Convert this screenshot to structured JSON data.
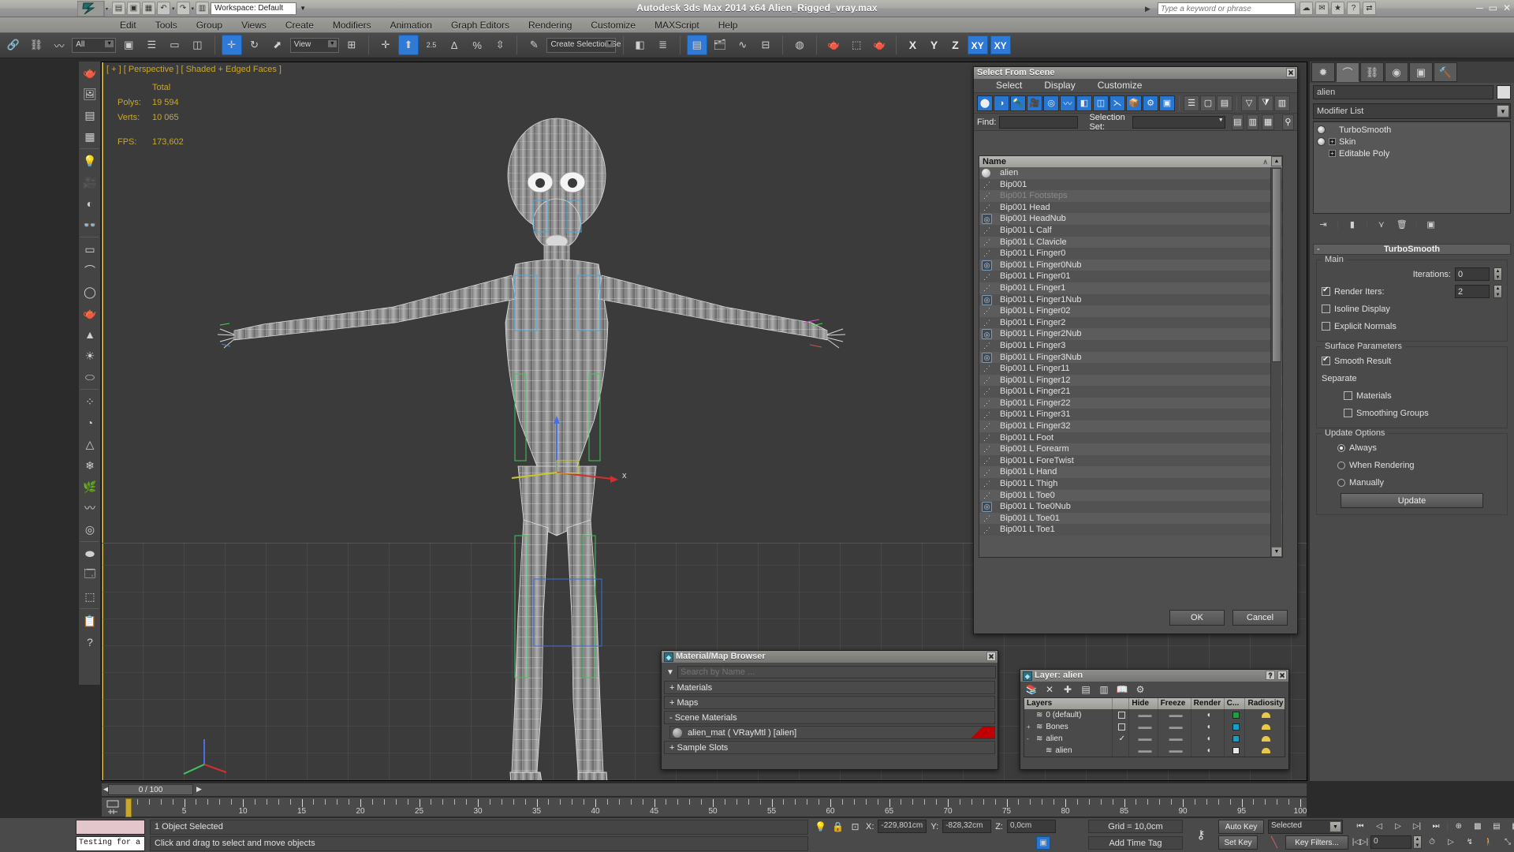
{
  "titlebar": {
    "title": "Autodesk 3ds Max  2014 x64    Alien_Rigged_vray.max",
    "quick_access": [
      "new-icon",
      "open-icon",
      "save-icon",
      "undo-icon",
      "redo-icon",
      "setproject-icon"
    ],
    "workspace_label": "Workspace: Default",
    "search_placeholder": "Type a keyword or phrase",
    "window_buttons": [
      "minimize",
      "maximize",
      "close"
    ]
  },
  "menu": {
    "items": [
      "Edit",
      "Tools",
      "Group",
      "Views",
      "Create",
      "Modifiers",
      "Animation",
      "Graph Editors",
      "Rendering",
      "Customize",
      "MAXScript",
      "Help"
    ]
  },
  "toolbar": {
    "selection_filter": "All",
    "reference_coord": "View",
    "named_selection_sets": "Create Selection Se",
    "axis_buttons": [
      "X",
      "Y",
      "Z"
    ],
    "axis_plane": "XY",
    "axis_plane_snap": "XY",
    "percent_snap_label": "%",
    "angle_snap_label": "2.5"
  },
  "viewport": {
    "label": "[ + ] [ Perspective ] [ Shaded + Edged Faces ]",
    "stats_header": "Total",
    "stats": [
      {
        "label": "Polys:",
        "value": "19 594"
      },
      {
        "label": "Verts:",
        "value": "10 065"
      }
    ],
    "fps_label": "FPS:",
    "fps_value": "173,602",
    "accent_color": "#c9a72c"
  },
  "select_from_scene": {
    "title": "Select From Scene",
    "menus": [
      "Select",
      "Display",
      "Customize"
    ],
    "find_label": "Find:",
    "find_value": "",
    "selection_set_label": "Selection Set:",
    "selection_set_value": "",
    "column_header": "Name",
    "ok_label": "OK",
    "cancel_label": "Cancel",
    "rows": [
      {
        "name": "alien",
        "icon": "sphere-icon",
        "dim": false
      },
      {
        "name": "Bip001",
        "icon": "bone-icon",
        "dim": false
      },
      {
        "name": "Bip001 Footsteps",
        "icon": "bone-icon",
        "dim": true
      },
      {
        "name": "Bip001 Head",
        "icon": "bone-icon",
        "dim": false
      },
      {
        "name": "Bip001 HeadNub",
        "icon": "dummy-icon",
        "dim": false
      },
      {
        "name": "Bip001 L Calf",
        "icon": "bone-icon",
        "dim": false
      },
      {
        "name": "Bip001 L Clavicle",
        "icon": "bone-icon",
        "dim": false
      },
      {
        "name": "Bip001 L Finger0",
        "icon": "bone-icon",
        "dim": false
      },
      {
        "name": "Bip001 L Finger0Nub",
        "icon": "dummy-icon",
        "dim": false
      },
      {
        "name": "Bip001 L Finger01",
        "icon": "bone-icon",
        "dim": false
      },
      {
        "name": "Bip001 L Finger1",
        "icon": "bone-icon",
        "dim": false
      },
      {
        "name": "Bip001 L Finger1Nub",
        "icon": "dummy-icon",
        "dim": false
      },
      {
        "name": "Bip001 L Finger02",
        "icon": "bone-icon",
        "dim": false
      },
      {
        "name": "Bip001 L Finger2",
        "icon": "bone-icon",
        "dim": false
      },
      {
        "name": "Bip001 L Finger2Nub",
        "icon": "dummy-icon",
        "dim": false
      },
      {
        "name": "Bip001 L Finger3",
        "icon": "bone-icon",
        "dim": false
      },
      {
        "name": "Bip001 L Finger3Nub",
        "icon": "dummy-icon",
        "dim": false
      },
      {
        "name": "Bip001 L Finger11",
        "icon": "bone-icon",
        "dim": false
      },
      {
        "name": "Bip001 L Finger12",
        "icon": "bone-icon",
        "dim": false
      },
      {
        "name": "Bip001 L Finger21",
        "icon": "bone-icon",
        "dim": false
      },
      {
        "name": "Bip001 L Finger22",
        "icon": "bone-icon",
        "dim": false
      },
      {
        "name": "Bip001 L Finger31",
        "icon": "bone-icon",
        "dim": false
      },
      {
        "name": "Bip001 L Finger32",
        "icon": "bone-icon",
        "dim": false
      },
      {
        "name": "Bip001 L Foot",
        "icon": "bone-icon",
        "dim": false
      },
      {
        "name": "Bip001 L Forearm",
        "icon": "bone-icon",
        "dim": false
      },
      {
        "name": "Bip001 L ForeTwist",
        "icon": "bone-icon",
        "dim": false
      },
      {
        "name": "Bip001 L Hand",
        "icon": "bone-icon",
        "dim": false
      },
      {
        "name": "Bip001 L Thigh",
        "icon": "bone-icon",
        "dim": false
      },
      {
        "name": "Bip001 L Toe0",
        "icon": "bone-icon",
        "dim": false
      },
      {
        "name": "Bip001 L Toe0Nub",
        "icon": "dummy-icon",
        "dim": false
      },
      {
        "name": "Bip001 L Toe01",
        "icon": "bone-icon",
        "dim": false
      },
      {
        "name": "Bip001 L Toe1",
        "icon": "bone-icon",
        "dim": false
      }
    ]
  },
  "material_browser": {
    "title": "Material/Map Browser",
    "search_placeholder": "Search by Name ...",
    "groups": [
      {
        "label": "+ Materials"
      },
      {
        "label": "+ Maps"
      },
      {
        "label": "-  Scene Materials"
      }
    ],
    "scene_material": "alien_mat  ( VRayMtl )  [alien]",
    "sample_slots": "+ Sample Slots"
  },
  "layer_panel": {
    "title": "Layer: alien",
    "columns": [
      "Layers",
      "",
      "Hide",
      "Freeze",
      "Render",
      "C...",
      "Radiosity"
    ],
    "rows": [
      {
        "name": "0 (default)",
        "current": false,
        "indent": 0,
        "color": "#1aa33c",
        "expander": ""
      },
      {
        "name": "Bones",
        "current": false,
        "indent": 0,
        "color": "#1a9ec4",
        "expander": "+"
      },
      {
        "name": "alien",
        "current": true,
        "indent": 0,
        "color": "#1a9ec4",
        "expander": "-"
      },
      {
        "name": "alien",
        "current": false,
        "indent": 1,
        "color": "#e8e8e8",
        "expander": ""
      }
    ]
  },
  "command_panel": {
    "tabs": [
      "create-tab",
      "modify-tab",
      "hierarchy-tab",
      "motion-tab",
      "display-tab",
      "utilities-tab"
    ],
    "active_tab_index": 1,
    "object_name": "alien",
    "modifier_list_label": "Modifier List",
    "modifier_stack": [
      {
        "name": "TurboSmooth",
        "has_bulb": true,
        "has_plus": false
      },
      {
        "name": "Skin",
        "has_bulb": true,
        "has_plus": true
      },
      {
        "name": "Editable Poly",
        "has_bulb": false,
        "has_plus": true
      }
    ],
    "rollout": {
      "title": "TurboSmooth",
      "expand_sign": "-",
      "groups": [
        {
          "label": "Main",
          "fields": [
            {
              "type": "spinner",
              "label": "Iterations:",
              "value": "0",
              "checkbox": null
            },
            {
              "type": "spinner",
              "label": "Render Iters:",
              "value": "2",
              "checkbox": true
            },
            {
              "type": "checkbox",
              "label": "Isoline Display",
              "checked": false
            },
            {
              "type": "checkbox",
              "label": "Explicit Normals",
              "checked": false
            }
          ]
        },
        {
          "label": "Surface Parameters",
          "fields": [
            {
              "type": "checkbox",
              "label": "Smooth Result",
              "checked": true
            },
            {
              "type": "text",
              "label": "Separate"
            },
            {
              "type": "checkbox-indent",
              "label": "Materials",
              "checked": false
            },
            {
              "type": "checkbox-indent",
              "label": "Smoothing Groups",
              "checked": false
            }
          ]
        },
        {
          "label": "Update Options",
          "fields": [
            {
              "type": "radio",
              "label": "Always",
              "checked": true
            },
            {
              "type": "radio",
              "label": "When Rendering",
              "checked": false
            },
            {
              "type": "radio",
              "label": "Manually",
              "checked": false
            },
            {
              "type": "button",
              "label": "Update"
            }
          ]
        }
      ]
    }
  },
  "timeline": {
    "current_frame_display": "0 / 100",
    "tick_labels": [
      "5",
      "10",
      "15",
      "20",
      "25",
      "30",
      "35",
      "40",
      "45",
      "50",
      "55",
      "60",
      "65",
      "70",
      "75",
      "80",
      "85",
      "90",
      "95",
      "100"
    ],
    "range_start": 0,
    "range_end": 100,
    "slider_frame": 0
  },
  "statusbar": {
    "maxscript_listener": "Testing for a",
    "selection_status": "1 Object Selected",
    "prompt": "Click and drag to select and move objects",
    "coords": [
      {
        "axis": "X:",
        "value": "-229,801cm"
      },
      {
        "axis": "Y:",
        "value": "-828,32cm"
      },
      {
        "axis": "Z:",
        "value": "0,0cm"
      }
    ],
    "grid": "Grid = 10,0cm",
    "add_time_tag": "Add Time Tag",
    "auto_key": "Auto Key",
    "set_key": "Set Key",
    "key_mode": "Selected",
    "key_filters": "Key Filters...",
    "frame_field": "0"
  }
}
